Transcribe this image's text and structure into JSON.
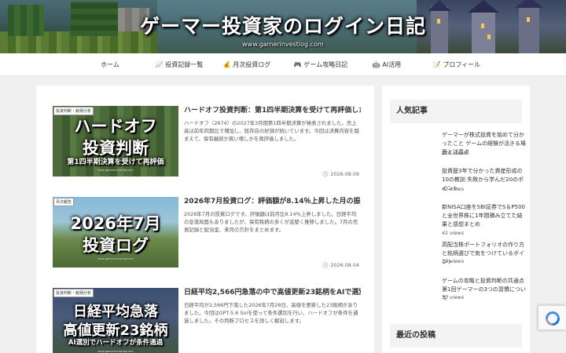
{
  "header": {
    "title": "ゲーマー投資家のログイン日記",
    "url": "www.gamerinvestlog.com"
  },
  "nav": {
    "items": [
      {
        "label": "ホーム",
        "icon": "home-icon"
      },
      {
        "label": "📈 投資記録一覧"
      },
      {
        "label": "💰 月次投資ログ"
      },
      {
        "label": "🎮 ゲーム攻略日記"
      },
      {
        "label": "🤖 AI活用"
      },
      {
        "label": "📝 プロフィール"
      }
    ]
  },
  "posts": [
    {
      "category": "投資判断・銘柄分析",
      "title": "ハードオフ投資判断：第1四半期決算を受けて再評価した結果をまとめます",
      "snippet": "ハードオフ（2674）の2027年3月期第1四半期決算が発表されました。売上高は前年同期比で増加し、既存店の好調が続いています。今回は決算内容を踏まえて、保有継続か買い増しかを再評価しました。",
      "date": "2026.08.09",
      "thumb_lines": [
        "ハードオフ",
        "投資判断",
        "第1四半期決算を受けて再評価"
      ],
      "thumb_url": "www.gamerinvestlog.com"
    },
    {
      "category": "月次報告",
      "title": "2026年7月投資ログ：評価額が8.14％上昇した月の振り返りと今後の方針",
      "snippet": "2026年7月の投資ログです。評価額は前月比8.14％上昇しました。日経平均の急落局面もありましたが、保有銘柄の多くが底堅く推移しました。7月の売買記録と配当金、来月の方針をまとめます。",
      "date": "2026.08.04",
      "thumb_lines": [
        "2026年7月",
        "投資ログ"
      ],
      "thumb_url": "www.gamerinvestlog.com"
    },
    {
      "category": "投資判断・銘柄分析",
      "title": "日経平均2,566円急落の中で高値更新23銘柄をAIで選別した結果を公開します",
      "snippet": "日経平均が2,566円下落した2026年7月28日、高値を更新した23銘柄がありました。今回はGPT-5.6 Solを使って条件選別を行い、ハードオフが条件を通過しました。その判断プロセスを詳しく解説します。",
      "date": "",
      "thumb_lines": [
        "日経平均急落",
        "高値更新23銘柄",
        "AI選別でハードオフが条件通過"
      ],
      "thumb_url": "www.gamerinvestlog.com"
    }
  ],
  "sidebar": {
    "popular_title": "人気記事",
    "popular": [
      {
        "title": "ゲーマーが株式投資を始めて分かったこと ゲームの経験が活きる場面と注意点",
        "views": "218 views"
      },
      {
        "title": "投資歴3年で分かった資産形成の10の教訓 失敗から学んだ20のポイント",
        "views": "42 views"
      },
      {
        "title": "新NISA口座をSBI証券でS＆P500と全世界株に1年間積み立てた結果と感想まとめ",
        "views": "41 views"
      },
      {
        "title": "高配当株ポートフォリオの作り方と銘柄選びで気をつけているポイント",
        "views": "39 views"
      },
      {
        "title": "ゲームの攻略と投資判断の共通点 第1回ゲーマーの3つの習慣について",
        "views": "32 views"
      }
    ],
    "second_title": "最近の投稿"
  }
}
